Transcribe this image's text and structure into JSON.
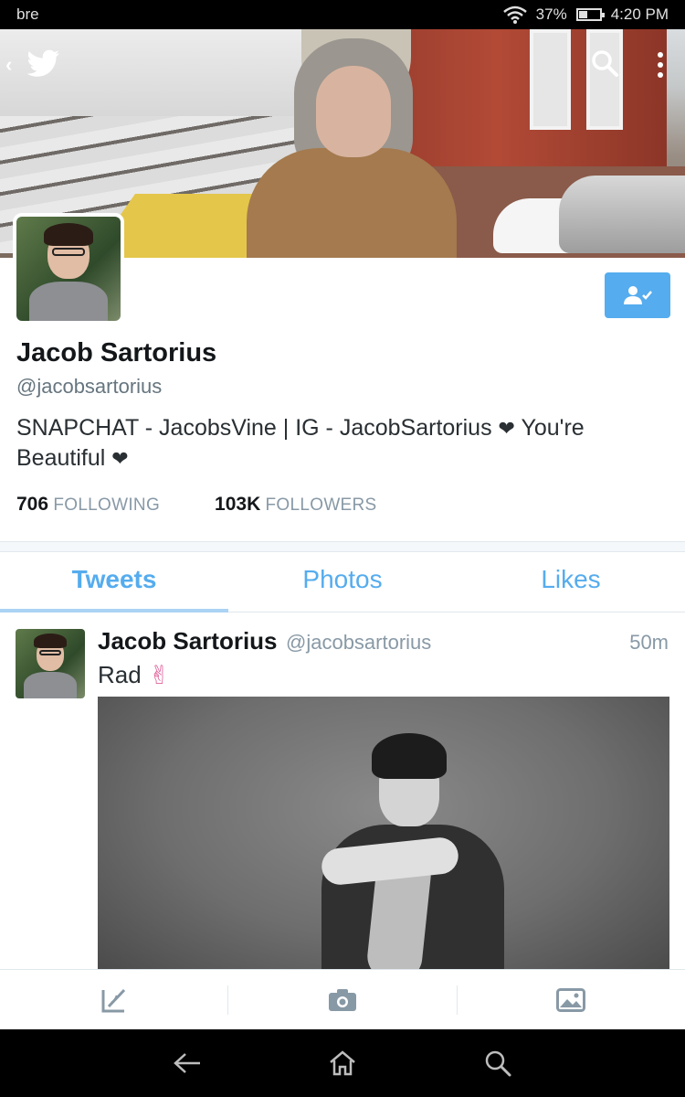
{
  "status_bar": {
    "carrier": "bre",
    "battery": "37%",
    "battery_level": 0.37,
    "time": "4:20 PM"
  },
  "profile": {
    "name": "Jacob Sartorius",
    "handle": "@jacobsartorius",
    "bio_part1": "SNAPCHAT - JacobsVine | IG - JacobSartorius",
    "bio_heart": "❤",
    "bio_part2": " You're Beautiful ",
    "bio_heart2": "❤",
    "following_count": "706",
    "following_label": "Following",
    "followers_count": "103K",
    "followers_label": "Followers"
  },
  "tabs": [
    {
      "label": "Tweets",
      "active": true
    },
    {
      "label": "Photos",
      "active": false
    },
    {
      "label": "Likes",
      "active": false
    }
  ],
  "tweet": {
    "name": "Jacob Sartorius",
    "handle": "@jacobsartorius",
    "time": "50m",
    "text": "Rad",
    "emoji": "✌"
  },
  "colors": {
    "accent": "#55acee",
    "text": "#292f33",
    "muted": "#8899a6"
  },
  "icons": {
    "back": "back-arrow-icon",
    "brand": "twitter-bird-icon",
    "search": "search-icon",
    "overflow": "overflow-menu-icon",
    "follow": "following-user-icon",
    "compose": "compose-tweet-icon",
    "camera": "camera-icon",
    "gallery": "photo-gallery-icon",
    "nav_back": "nav-back-icon",
    "nav_home": "nav-home-icon",
    "nav_search": "nav-search-icon"
  }
}
